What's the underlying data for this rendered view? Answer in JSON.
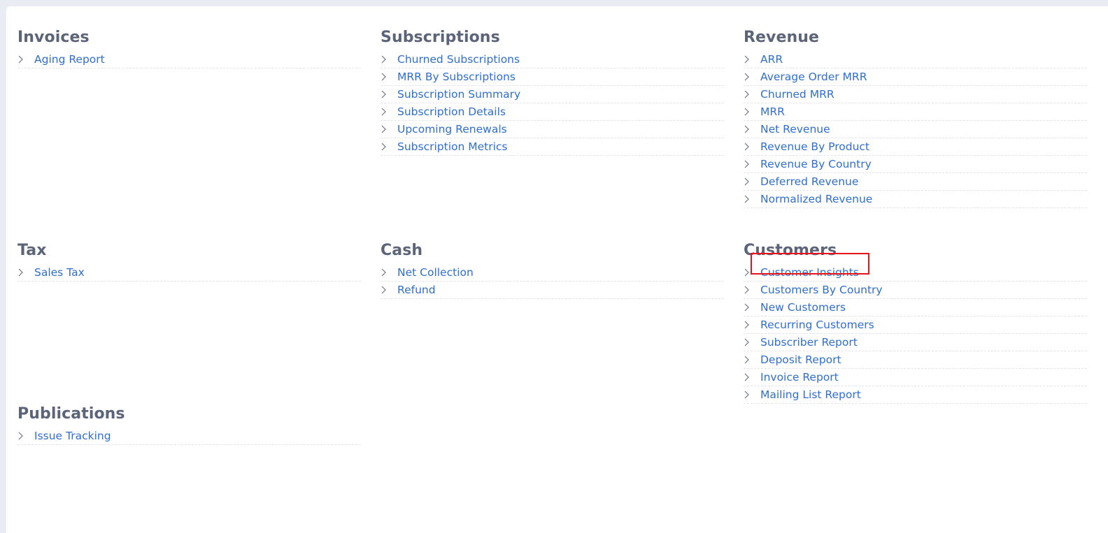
{
  "sections": [
    {
      "title": "Invoices",
      "items": [
        "Aging Report"
      ]
    },
    {
      "title": "Subscriptions",
      "items": [
        "Churned Subscriptions",
        "MRR By Subscriptions",
        "Subscription Summary",
        "Subscription Details",
        "Upcoming Renewals",
        "Subscription Metrics"
      ]
    },
    {
      "title": "Revenue",
      "items": [
        "ARR",
        "Average Order MRR",
        "Churned MRR",
        "MRR",
        "Net Revenue",
        "Revenue By Product",
        "Revenue By Country",
        "Deferred Revenue",
        "Normalized Revenue"
      ]
    },
    {
      "title": "Tax",
      "items": [
        "Sales Tax"
      ]
    },
    {
      "title": "Cash",
      "items": [
        "Net Collection",
        "Refund"
      ]
    },
    {
      "title": "Customers",
      "items": [
        "Customer Insights",
        "Customers By Country",
        "New Customers",
        "Recurring Customers",
        "Subscriber Report",
        "Deposit Report",
        "Invoice Report",
        "Mailing List Report"
      ]
    },
    {
      "title": "Publications",
      "items": [
        "Issue Tracking"
      ]
    }
  ],
  "highlighted_item": "Customer Insights",
  "colors": {
    "link": "#2f6fd0",
    "heading": "#5b6478",
    "highlight": "#e8141b",
    "background": "#e9edf3",
    "panel": "#ffffff"
  },
  "icons": {
    "item_marker": "chevron-right-icon"
  }
}
